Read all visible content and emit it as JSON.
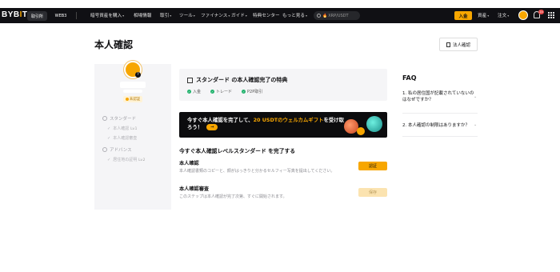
{
  "nav": {
    "logo_text": "BYB",
    "logo_dot": "I",
    "logo_end": "T",
    "tab_exchange": "取引所",
    "tab_web3": "WEB3",
    "items": [
      {
        "label": "暗号資産を購入",
        "caret": true
      },
      {
        "label": "相場情報",
        "caret": false
      },
      {
        "label": "取引",
        "caret": true
      },
      {
        "label": "ツール",
        "caret": true
      },
      {
        "label": "ファイナンス",
        "caret": true
      },
      {
        "label": "ガイド",
        "caret": true
      },
      {
        "label": "特典センター",
        "caret": false
      },
      {
        "label": "もっと見る",
        "caret": true
      }
    ],
    "search_placeholder": "XRP/USDT",
    "deposit": "入金",
    "assets": "資産",
    "orders": "注文",
    "notification_count": "24"
  },
  "page": {
    "title": "本人確認",
    "corporate_button": "法人確認"
  },
  "profile": {
    "status_badge": "未認証",
    "standard_label": "スタンダード",
    "standard_sub": [
      {
        "label": "本人確認",
        "level": "Lv.1"
      },
      {
        "label": "本人確認審査",
        "level": ""
      }
    ],
    "advanced_label": "アドバンス",
    "advanced_sub": [
      {
        "label": "居住地の証明",
        "level": "Lv.2"
      }
    ]
  },
  "benefits": {
    "title": "スタンダード の本人確認完了の特典",
    "items": [
      "入金",
      "トレード",
      "P2P取引"
    ]
  },
  "promo": {
    "text_before": "今すぐ本人確認を完了して、",
    "text_highlight": "20 USDTのウェルカムギフト",
    "text_after": "を受け取ろう！",
    "arrow": "→"
  },
  "tasks": {
    "section_title": "今すぐ本人確認レベルスタンダード を完了する",
    "task1_title": "本人確認",
    "task1_desc": "本人確認書類のコピーと、顔がはっきりと分かるセルフィー写真を提出してください。",
    "task1_button": "認証",
    "task2_title": "本人確認審査",
    "task2_desc": "このステップは本人確認が完了次第、すぐに開始されます。",
    "task2_button": "保存"
  },
  "faq": {
    "title": "FAQ",
    "q1": "1. 私の居住国が記載されていないのはなぜですか？",
    "q2": "2. 本人確認の制限はありますか？"
  }
}
